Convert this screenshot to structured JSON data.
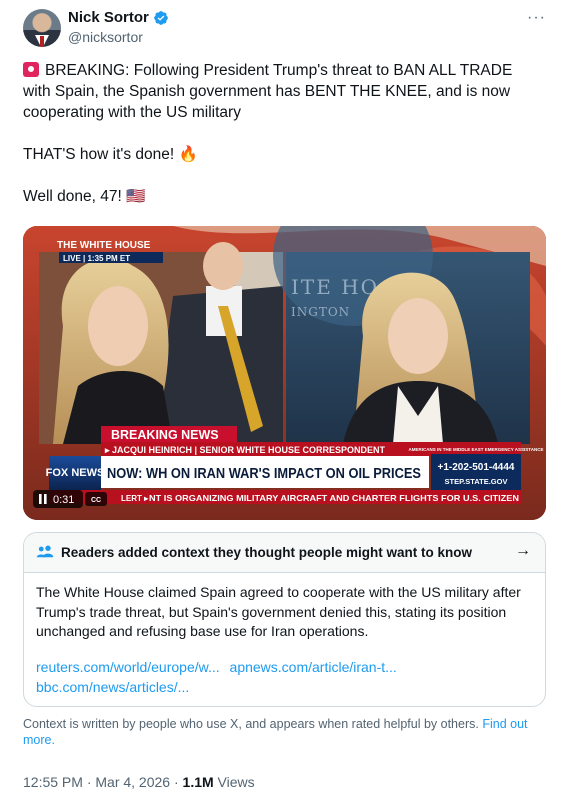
{
  "author": {
    "display_name": "Nick Sortor",
    "handle": "@nicksortor",
    "verified_icon": "verified-badge-icon",
    "more_label": "···"
  },
  "tweet": {
    "paragraph_1": "BREAKING: Following President Trump's threat to BAN ALL TRADE with Spain, the Spanish government has BENT THE KNEE, and is now cooperating with the US military",
    "paragraph_2": "THAT'S how it's done! 🔥",
    "paragraph_3": "Well done, 47! 🇺🇸"
  },
  "video": {
    "location_bug": "THE WHITE HOUSE",
    "live_bug": "LIVE | 1:35 PM ET",
    "breaking_label": "BREAKING NEWS",
    "correspondent": "▸ JACQUI HEINRICH | SENIOR WHITE HOUSE CORRESPONDENT",
    "headline": "NOW: WH ON IRAN WAR'S IMPACT ON OIL PRICES",
    "hotline_title": "AMERICANS IN THE MIDDLE EAST EMERGENCY ASSISTANCE",
    "hotline_number": "+1-202-501-4444",
    "hotline_site": "STEP.STATE.GOV",
    "ticker": "NT IS ORGANIZING MILITARY AIRCRAFT AND CHARTER FLIGHTS FOR U.S. CITIZEN",
    "ticker_alert": "LERT ▸",
    "network_logo": "FOX NEWS",
    "wall_text_1": "ITE HO",
    "wall_text_2": "INGTON",
    "timestamp": "0:31",
    "cc_label": "CC",
    "pause_icon": "pause-icon"
  },
  "community_note": {
    "title": "Readers added context they thought people might want to know",
    "arrow": "→",
    "body": "The White House claimed Spain agreed to cooperate with the US military after Trump's trade threat, but Spain's government denied this, stating its position unchanged and refusing base use for Iran operations.",
    "links": [
      "reuters.com/world/europe/w...",
      "apnews.com/article/iran-t...",
      "bbc.com/news/articles/..."
    ]
  },
  "disclaimer": {
    "text": "Context is written by people who use X, and appears when rated helpful by others.",
    "link": "Find out more."
  },
  "meta": {
    "time": "12:55 PM · Mar 4, 2026 · ",
    "views_count": "1.1M",
    "views_label": " Views"
  }
}
